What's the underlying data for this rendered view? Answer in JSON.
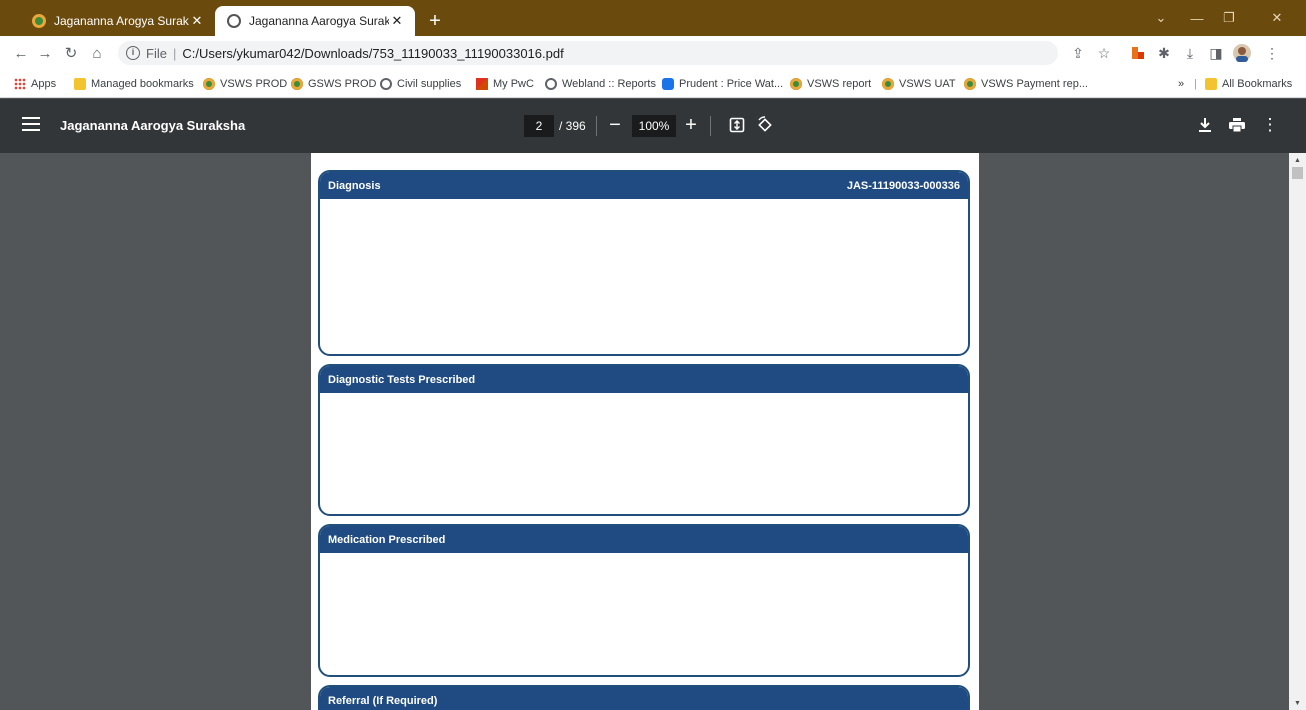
{
  "browser": {
    "tabs": [
      {
        "title": "Jagananna Arogya Suraksha",
        "active": false,
        "icon": "vsws-favicon"
      },
      {
        "title": "Jagananna Aarogya Suraksha",
        "active": true,
        "icon": "globe-icon"
      }
    ],
    "new_tab_label": "+",
    "address": {
      "scheme": "File",
      "separator": "|",
      "url": "C:/Users/ykumar042/Downloads/753_11190033_11190033016.pdf"
    },
    "bookmarks": [
      {
        "label": "Apps",
        "icon": "apps-icon"
      },
      {
        "label": "Managed bookmarks",
        "icon": "folder-icon"
      },
      {
        "label": "VSWS PROD",
        "icon": "vsws-icon"
      },
      {
        "label": "GSWS PROD",
        "icon": "vsws-icon"
      },
      {
        "label": "Civil supplies",
        "icon": "globe-icon"
      },
      {
        "label": "My PwC",
        "icon": "pwc-icon"
      },
      {
        "label": "Webland :: Reports",
        "icon": "globe-icon"
      },
      {
        "label": "Prudent : Price Wat...",
        "icon": "prudent-icon"
      },
      {
        "label": "VSWS report",
        "icon": "vsws-icon"
      },
      {
        "label": "VSWS UAT",
        "icon": "vsws-icon"
      },
      {
        "label": "VSWS Payment rep...",
        "icon": "vsws-icon"
      }
    ],
    "bookmarks_overflow": "»",
    "all_bookmarks": "All Bookmarks"
  },
  "pdf_viewer": {
    "title": "Jagananna Aarogya Suraksha",
    "current_page": "2",
    "total_pages": "/ 396",
    "zoom": "100%"
  },
  "document": {
    "sections": [
      {
        "title": "Diagnosis",
        "ref": "JAS-11190033-000336"
      },
      {
        "title": "Diagnostic Tests Prescribed",
        "ref": ""
      },
      {
        "title": "Medication Prescribed",
        "ref": ""
      },
      {
        "title": "Referral (If Required)",
        "ref": ""
      }
    ]
  },
  "colors": {
    "tab_strip": "#6b4a0e",
    "pdf_toolbar": "#323639",
    "viewer_background": "#525659",
    "section_header": "#1f4b82"
  }
}
